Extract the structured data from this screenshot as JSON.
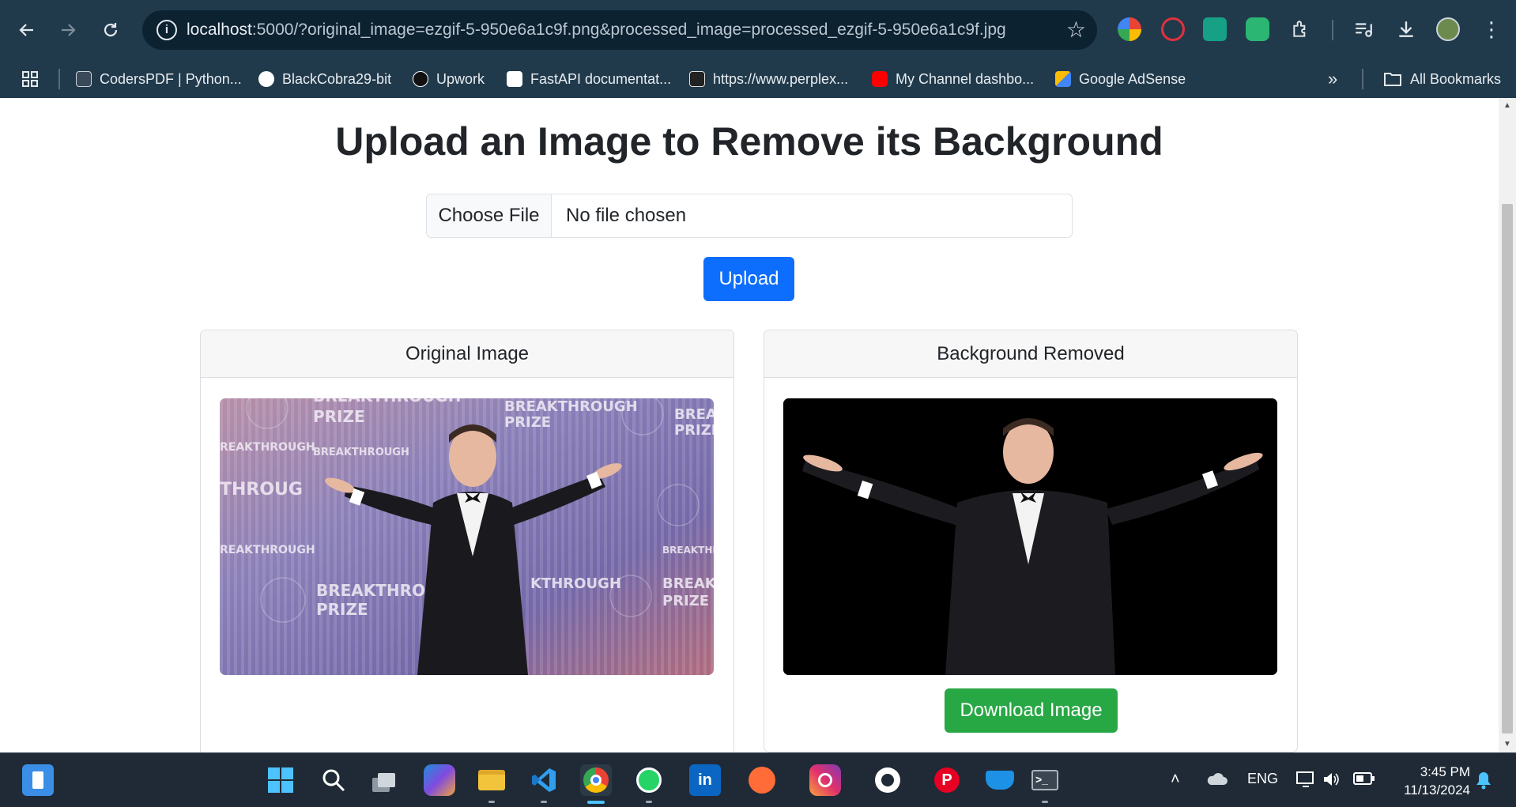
{
  "browser": {
    "url_host": "localhost",
    "url_rest": ":5000/?original_image=ezgif-5-950e6a1c9f.png&processed_image=processed_ezgif-5-950e6a1c9f.jpg",
    "bookmarks": [
      {
        "label": "CodersPDF | Python...",
        "icon": "coderspdf-icon",
        "color": "#3a4a5a"
      },
      {
        "label": "BlackCobra29-bit",
        "icon": "github-icon",
        "color": "#ffffff"
      },
      {
        "label": "Upwork",
        "icon": "upwork-icon",
        "color": "#111111"
      },
      {
        "label": "FastAPI documentat...",
        "icon": "fastapi-icon",
        "color": "#ffffff"
      },
      {
        "label": "https://www.perplex...",
        "icon": "perplexity-icon",
        "color": "#222222"
      },
      {
        "label": "My Channel dashbo...",
        "icon": "youtube-icon",
        "color": "#ff0000"
      },
      {
        "label": "Google AdSense",
        "icon": "adsense-icon",
        "color": "#fbbc04"
      }
    ],
    "all_bookmarks": "All Bookmarks"
  },
  "page": {
    "title": "Upload an Image to Remove its Background",
    "choose_file": "Choose File",
    "no_file": "No file chosen",
    "upload": "Upload",
    "original_header": "Original Image",
    "removed_header": "Background Removed",
    "download": "Download Image"
  },
  "taskbar": {
    "language": "ENG",
    "time": "3:45 PM",
    "date": "11/13/2024"
  },
  "colors": {
    "primary": "#0d6efd",
    "success": "#28a745",
    "chrome_bg": "#213a4b"
  }
}
